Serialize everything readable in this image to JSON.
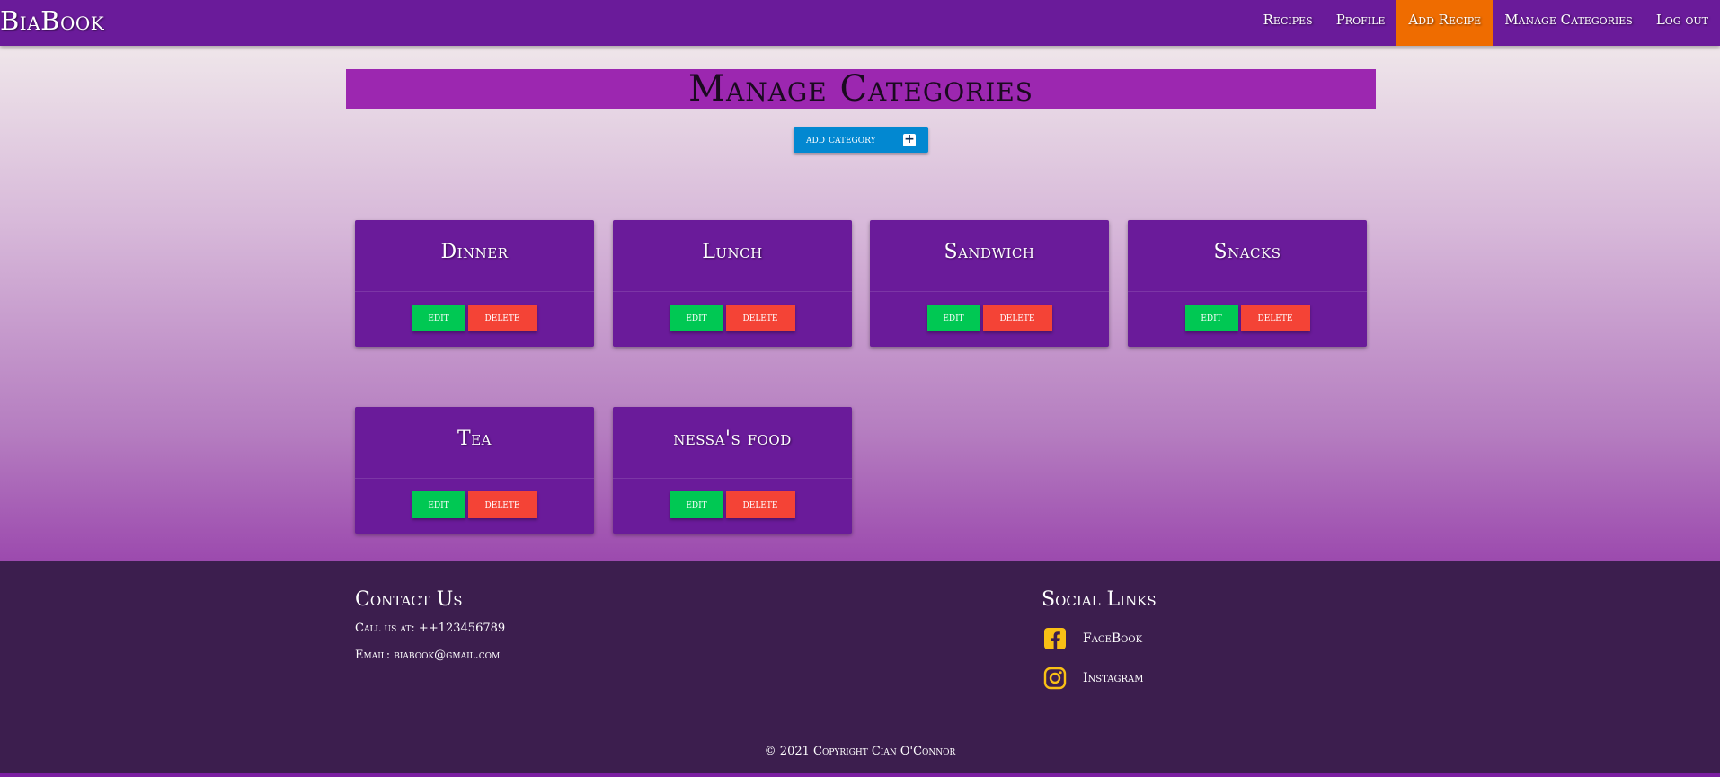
{
  "nav": {
    "brand": "BiaBook",
    "links": [
      "Recipes",
      "Profile",
      "Add Recipe",
      "Manage Categories",
      "Log out"
    ],
    "active": "Add Recipe"
  },
  "page": {
    "title": "Manage Categories",
    "add_button": "ADD CATEGORY"
  },
  "categories": [
    {
      "name": "Dinner"
    },
    {
      "name": "Lunch"
    },
    {
      "name": "Sandwich"
    },
    {
      "name": "Snacks"
    },
    {
      "name": "Tea"
    },
    {
      "name": "nessa's food"
    }
  ],
  "card_buttons": {
    "edit": "EDIT",
    "delete": "DELETE"
  },
  "footer": {
    "contact_title": "Contact Us",
    "phone": "Call us at: ++123456789",
    "email": "Email: biabook@gmail.com",
    "social_title": "Social Links",
    "social": [
      {
        "label": "FaceBook",
        "icon": "facebook-icon"
      },
      {
        "label": "Instagram",
        "icon": "instagram-icon"
      }
    ],
    "copyright": "© 2021 Copyright Cian O'Connor"
  },
  "colors": {
    "nav": "#6a1b9a",
    "active_nav": "#ef6c00",
    "title_bar": "#9c27b0",
    "add_button": "#0288d1",
    "edit": "#00c853",
    "delete": "#f44336",
    "footer": "#3c1e4e",
    "social_icon": "#f9c015"
  }
}
